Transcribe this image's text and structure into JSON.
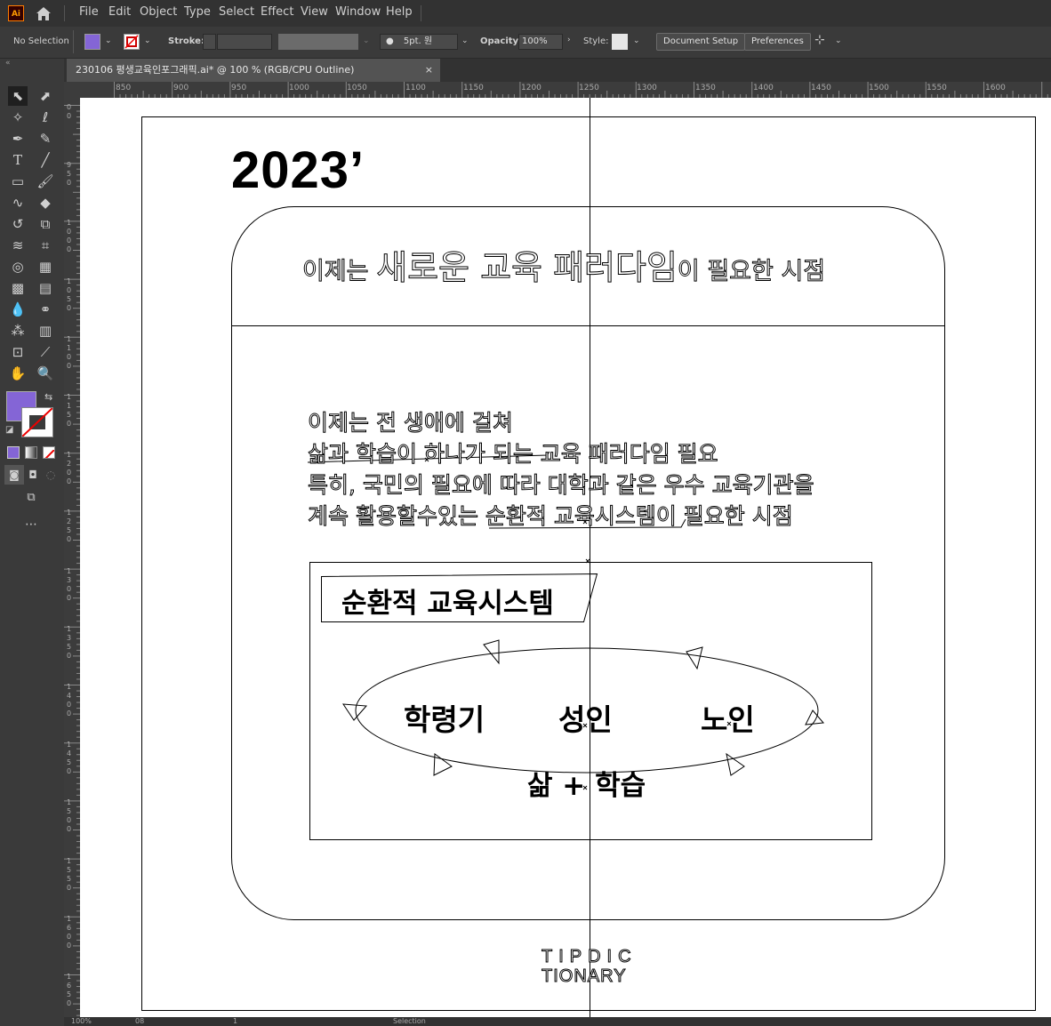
{
  "app": {
    "logo": "Ai"
  },
  "menu": [
    "File",
    "Edit",
    "Object",
    "Type",
    "Select",
    "Effect",
    "View",
    "Window",
    "Help"
  ],
  "control": {
    "selection": "No Selection",
    "stroke_label": "Stroke:",
    "brush_value": "5pt. 원",
    "opacity_label": "Opacity:",
    "opacity_value": "100%",
    "style_label": "Style:",
    "doc_setup": "Document Setup",
    "preferences": "Preferences",
    "fill_color": "#8465d6"
  },
  "tab": {
    "title": "230106 평생교육인포그래픽.ai* @ 100 % (RGB/CPU Outline)",
    "close": "×"
  },
  "ruler": {
    "h_ticks": [
      "850",
      "900",
      "950",
      "1000",
      "1050",
      "1100",
      "1150",
      "1200",
      "1250",
      "1300",
      "1350",
      "1400",
      "1450",
      "1500",
      "1550",
      "1600"
    ],
    "v_ticks": [
      "0 0",
      "9 5 0",
      "1 0 0 0",
      "1 0 5 0",
      "1 1 0 0",
      "1 1 5 0",
      "1 2 0 0",
      "1 2 5 0",
      "1 3 0 0",
      "1 3 5 0",
      "1 4 0 0",
      "1 4 5 0",
      "1 5 0 0",
      "1 5 5 0",
      "1 6 0 0",
      "1 6 5 0"
    ]
  },
  "artwork": {
    "year": "2023’",
    "headline": {
      "prefix": "이제는 ",
      "big": "새로운 교육 패러다임",
      "suffix": "이 필요한 시점"
    },
    "body": [
      "이제는 전 생애에 걸쳐",
      "삶과 학습이 하나가 되는 교육 패러다임 필요",
      "특히, 국민의 필요에 따라 대학과 같은 우수 교육기관을",
      "계속 활용할수있는 순환적 교육시스템이 필요한 시점"
    ],
    "system_title": "순환적 교육시스템",
    "stages": [
      "학령기",
      "성인",
      "노인"
    ],
    "life_learning": "삶 + 학습",
    "brand_line1": "TIPDIC",
    "brand_line2": "TIONARY"
  },
  "status": {
    "zoom": "100%",
    "artboard": "08",
    "page": "1",
    "mode": "Selection"
  }
}
